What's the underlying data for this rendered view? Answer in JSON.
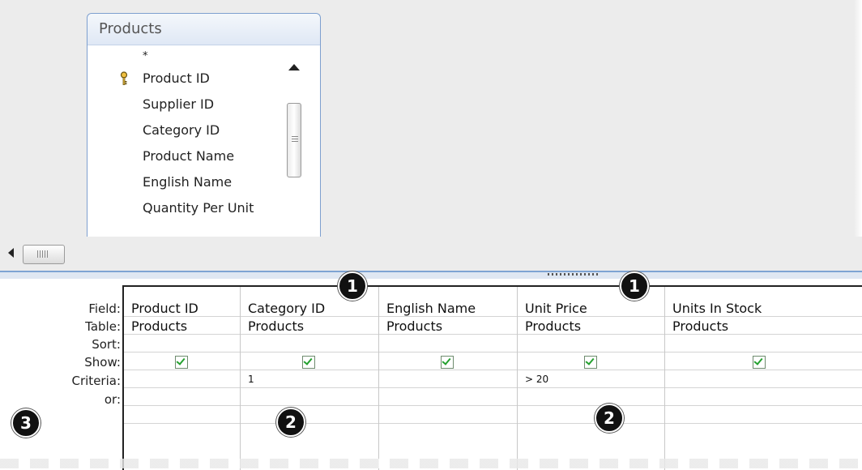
{
  "table": {
    "title": "Products",
    "fields": [
      "*",
      "Product ID",
      "Supplier ID",
      "Category ID",
      "Product Name",
      "English Name",
      "Quantity Per Unit"
    ]
  },
  "grid": {
    "row_labels": [
      "Field:",
      "Table:",
      "Sort:",
      "Show:",
      "Criteria:",
      "or:"
    ],
    "columns": [
      {
        "field": "Product ID",
        "table": "Products",
        "show": true,
        "criteria": "",
        "or": ""
      },
      {
        "field": "Category ID",
        "table": "Products",
        "show": true,
        "criteria": "1",
        "or": ""
      },
      {
        "field": "English Name",
        "table": "Products",
        "show": true,
        "criteria": "",
        "or": ""
      },
      {
        "field": "Unit Price",
        "table": "Products",
        "show": true,
        "criteria": "> 20",
        "or": ""
      },
      {
        "field": "Units In Stock",
        "table": "Products",
        "show": true,
        "criteria": "",
        "or": ""
      }
    ]
  },
  "callouts": {
    "c1a": "1",
    "c1b": "1",
    "c2a": "2",
    "c2b": "2",
    "c3": "3"
  },
  "icons": {
    "key": "primary-key-icon",
    "scroll_up": "scroll-up-arrow-icon",
    "scroll_down": "scroll-down-arrow-icon",
    "scroll_left": "scroll-left-arrow-icon"
  },
  "colors": {
    "check": "#24a12f",
    "title_border": "#7d9fcf",
    "splitter": "#7ea3d3"
  }
}
